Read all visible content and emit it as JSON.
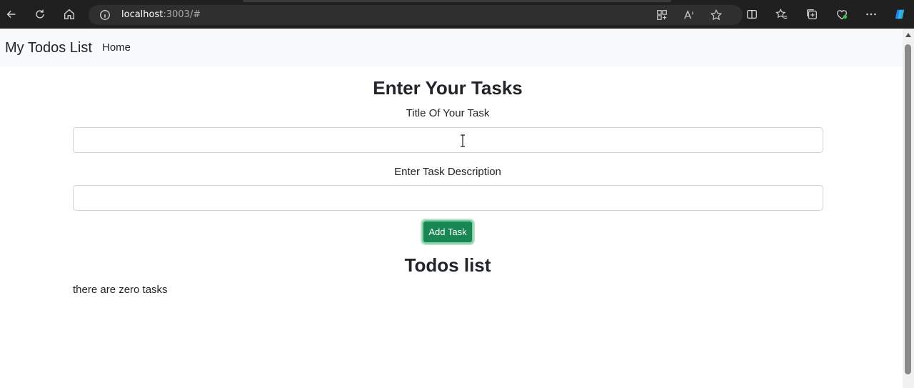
{
  "browser": {
    "url_host": "localhost",
    "url_rest": ":3003/#",
    "icons": [
      "back-icon",
      "reload-icon",
      "home-icon",
      "info-icon",
      "apps-icon",
      "read-aloud-icon",
      "favorite-star-icon",
      "split-screen-icon",
      "favorites-icon",
      "collections-icon",
      "browser-essentials-icon",
      "more-icon",
      "copilot-icon"
    ]
  },
  "navbar": {
    "brand": "My Todos List",
    "home_link": "Home"
  },
  "form": {
    "heading": "Enter Your Tasks",
    "title_label": "Title Of Your Task",
    "title_value": "",
    "desc_label": "Enter Task Description",
    "desc_value": "",
    "add_button": "Add Task"
  },
  "todos": {
    "heading": "Todos list",
    "empty_message": "there are zero tasks"
  },
  "colors": {
    "button_bg": "#198754",
    "navbar_bg": "#f8f9fa",
    "chrome_bg": "#202020"
  }
}
